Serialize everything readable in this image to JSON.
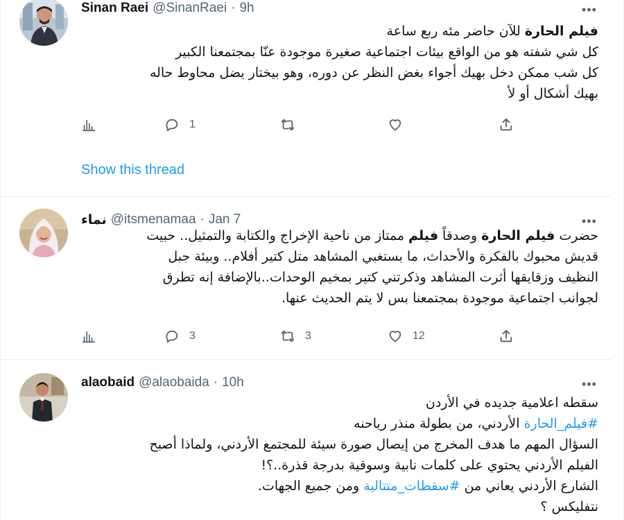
{
  "tweets": [
    {
      "name": "Sinan Raei",
      "handle": "@SinanRaei",
      "time": "9h",
      "lines": [
        [
          {
            "t": "فيلم الحارة",
            "b": true
          },
          {
            "t": " للآن حاضر مئه ربع ساعة"
          }
        ],
        [
          {
            "t": "كل شي شفته هو من الواقع بيئات اجتماعية صغيرة موجودة عنّا بمجتمعنا الكبير"
          }
        ],
        [
          {
            "t": "كل شب ممكن دخل بهيك أجواء بغض النظر عن دوره، وهو بيختار يضل محاوط حاله"
          }
        ],
        [
          {
            "t": "بهيك أشكال أو لأ"
          }
        ]
      ],
      "replies": "1",
      "retweets": "",
      "likes": "",
      "show_thread": "Show this thread"
    },
    {
      "name": "نماء",
      "handle": "@itsmenamaa",
      "time": "Jan 7",
      "lines": [
        [
          {
            "t": "حضرت "
          },
          {
            "t": "فيلم الحارة",
            "b": true
          },
          {
            "t": " وصدقاً "
          },
          {
            "t": "فيلم",
            "b": true
          },
          {
            "t": " ممتاز من ناحية الإخراج والكتابة والتمثيل.. حبيت"
          }
        ],
        [
          {
            "t": "قديش محبوك بالفكرة والأحداث، ما بستغبي المشاهد متل كتير أفلام.. وبيئة جبل"
          }
        ],
        [
          {
            "t": "النظيف وزقايقها أثرت المشاهد وذكرتني كتير بمخيم الوحدات..بالإضافة إنه تطرق"
          }
        ],
        [
          {
            "t": "لجوانب اجتماعية موجودة بمجتمعنا بس لا يتم الحديث عنها."
          }
        ]
      ],
      "replies": "3",
      "retweets": "3",
      "likes": "12"
    },
    {
      "name": "alaobaid",
      "handle": "@alaobaida",
      "time": "10h",
      "lines": [
        [
          {
            "t": "سقطه اعلامية جديده في الأردن"
          }
        ],
        [
          {
            "t": "#فيلم_الحارة",
            "h": true
          },
          {
            "t": " الأردني، من بطولة منذر رياحنه"
          }
        ],
        [
          {
            "t": "السؤال المهم ما هدف المخرج من إيصال صورة سيئة للمجتمع الأردني، ولماذا أصبح"
          }
        ],
        [
          {
            "t": "الفيلم الأردني يحتوي على كلمات نابية وسوقية بدرجة قذرة..؟!"
          }
        ],
        [
          {
            "t": "الشارع الأردني يعاني من "
          },
          {
            "t": "#سقطات_متتالية",
            "h": true
          },
          {
            "t": " ومن جميع الجهات."
          }
        ],
        [
          {
            "t": "نتفليكس ؟"
          }
        ]
      ]
    }
  ],
  "icons": {
    "more": "more-horizontal-icon",
    "analytics": "analytics-icon",
    "reply": "reply-icon",
    "retweet": "retweet-icon",
    "like": "heart-icon",
    "share": "share-icon"
  },
  "colors": {
    "link": "#1d9bf0",
    "muted": "#536471",
    "text": "#0f1419",
    "divider": "#e6ecf0"
  }
}
